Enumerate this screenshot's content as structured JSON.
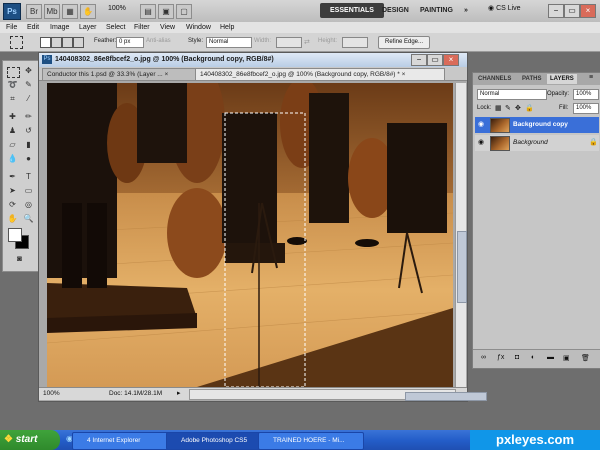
{
  "app": {
    "logo": "Ps",
    "zoom": "100%"
  },
  "workspaces": {
    "essentials": "ESSENTIALS",
    "design": "DESIGN",
    "painting": "PAINTING",
    "more": "»",
    "cs_live": "CS Live"
  },
  "menu": [
    "File",
    "Edit",
    "Image",
    "Layer",
    "Select",
    "Filter",
    "View",
    "Window",
    "Help"
  ],
  "options": {
    "feather_label": "Feather:",
    "feather_value": "0 px",
    "antialias": "Anti-alias",
    "style_label": "Style:",
    "style_value": "Normal",
    "width_label": "Width:",
    "height_label": "Height:",
    "refine_edge": "Refine Edge..."
  },
  "document": {
    "title": "140408302_86e8fbcef2_o.jpg @ 100% (Background copy, RGB/8#)",
    "tabs": [
      {
        "label": "Conductor this 1.psd @ 33.3% (Layer ...",
        "close": "×"
      },
      {
        "label": "140408302_86e8fbcef2_o.jpg @ 100% (Background copy, RGB/8#) *",
        "close": "×"
      }
    ],
    "status_zoom": "100%",
    "status_doc": "Doc: 14.1M/28.1M"
  },
  "panels": {
    "tabs": [
      "CHANNELS",
      "PATHS",
      "LAYERS"
    ],
    "blend_mode": "Normal",
    "opacity_label": "Opacity:",
    "opacity_value": "100%",
    "lock_label": "Lock:",
    "fill_label": "Fill:",
    "fill_value": "100%",
    "layers": [
      {
        "name": "Background copy",
        "selected": true
      },
      {
        "name": "Background",
        "selected": false
      }
    ]
  },
  "taskbar": {
    "start": "start",
    "tasks": [
      "4 Internet Explorer",
      "Adobe Photoshop CS5",
      "TRAINED HOERE - Mi..."
    ],
    "watermark": "pxleyes.com"
  },
  "colors": {
    "accent": "#3b6fd6",
    "selected_layer": "#3a6fd8",
    "taskbar": "#245ec9",
    "start": "#3fa33b"
  }
}
